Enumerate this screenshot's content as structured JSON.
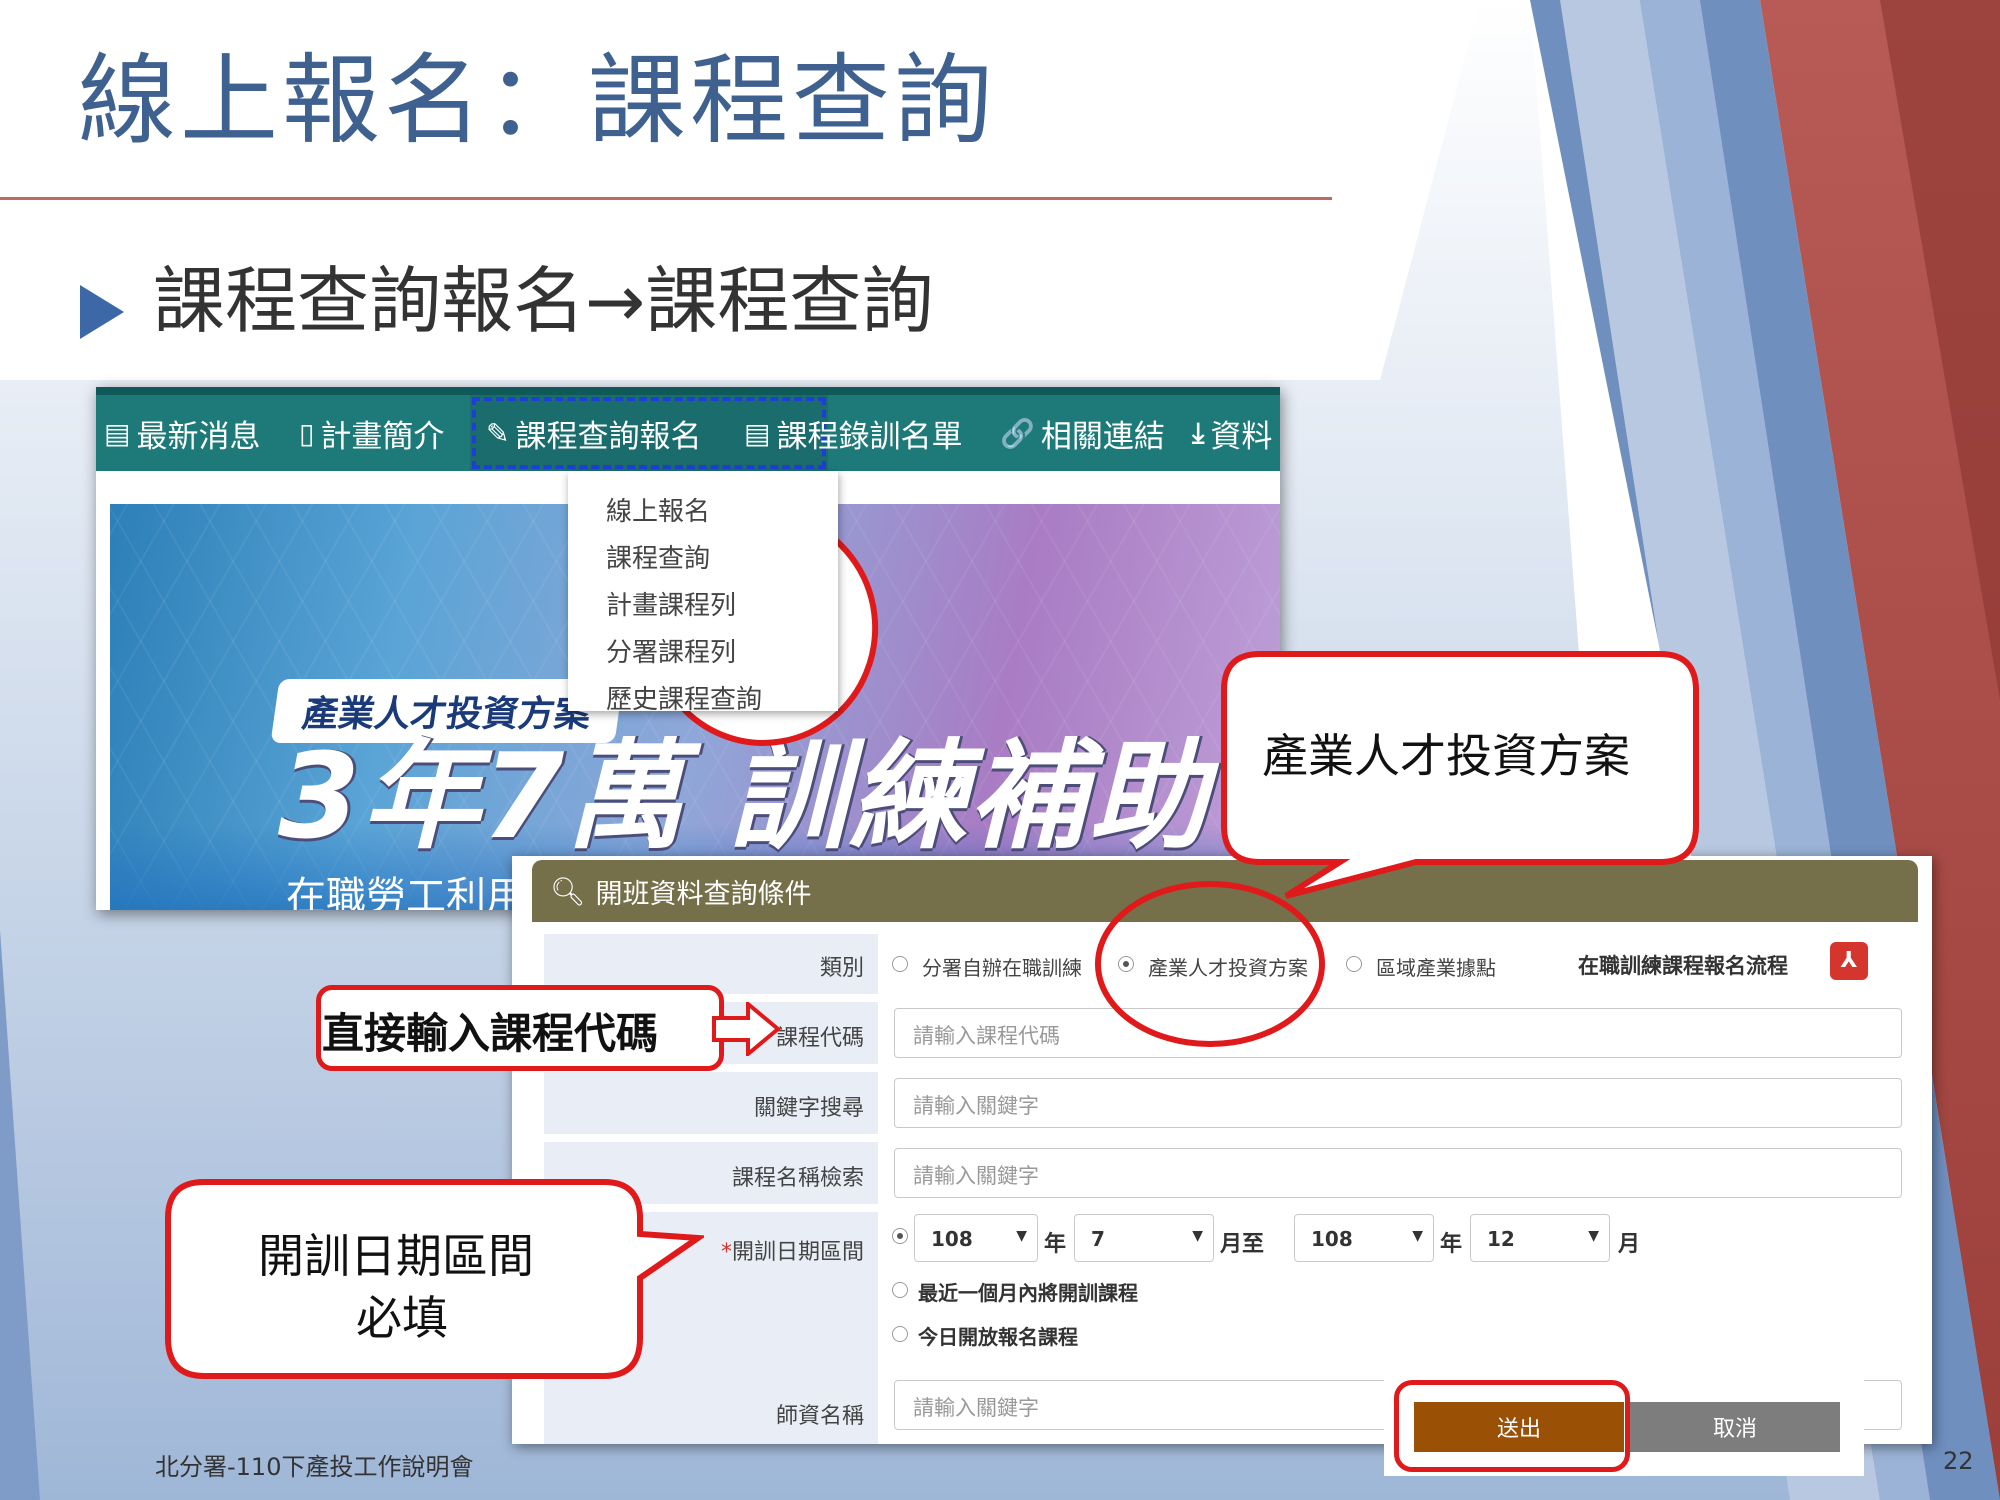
{
  "slide": {
    "title": "線上報名：課程查詢",
    "bullet": "課程查詢報名→課程查詢",
    "footer": "北分署-110下產投工作說明會",
    "page_number": "22"
  },
  "website": {
    "nav_items": [
      {
        "icon": "newspaper-icon",
        "label": "最新消息"
      },
      {
        "icon": "clipboard-icon",
        "label": "計畫簡介"
      },
      {
        "icon": "pencil-icon",
        "label": "課程查詢報名"
      },
      {
        "icon": "list-icon",
        "label": "課程錄訓名單"
      },
      {
        "icon": "link-icon",
        "label": "相關連結"
      },
      {
        "icon": "download-icon",
        "label": "資料"
      }
    ],
    "dropdown_items": [
      "線上報名",
      "課程查詢",
      "計畫課程列",
      "分署課程列",
      "歷史課程查詢"
    ],
    "banner": {
      "tag": "產業人才投資方案",
      "headline": "3年7萬 訓練補助",
      "subline": "在職勞工利用政府資源 提升技能以因應產業快速變動"
    }
  },
  "callouts": {
    "course_query": "課程\n查詢",
    "program": "產業人才投資方案",
    "enter_code": "直接輸入課程代碼",
    "date_range_line1": "開訓日期區間",
    "date_range_line2": "必填"
  },
  "form": {
    "header": "開班資料查詢條件",
    "category": {
      "label": "類別",
      "options": [
        {
          "text": "分署自辦在職訓練",
          "selected": false
        },
        {
          "text": "產業人才投資方案",
          "selected": true
        },
        {
          "text": "區域產業據點",
          "selected": false
        }
      ],
      "process_link": "在職訓練課程報名流程"
    },
    "course_code": {
      "label": "課程代碼",
      "placeholder": "請輸入課程代碼"
    },
    "keyword": {
      "label": "關鍵字搜尋",
      "placeholder": "請輸入關鍵字"
    },
    "course_name": {
      "label": "課程名稱檢索",
      "placeholder": "請輸入關鍵字"
    },
    "date_range": {
      "required_mark": "*",
      "label": "開訓日期區間",
      "from_year": "108",
      "year_unit": "年",
      "from_month": "7",
      "month_to": "月至",
      "to_year": "108",
      "to_month": "12",
      "month_unit": "月",
      "option_next_month": "最近一個月內將開訓課程",
      "option_today": "今日開放報名課程"
    },
    "teacher": {
      "label": "師資名稱",
      "placeholder": "請輸入關鍵字"
    },
    "submit_label": "送出",
    "cancel_label": "取消"
  },
  "colors": {
    "title_blue": "#3f6190",
    "nav_teal": "#1e7a79",
    "panel_olive": "#75704a",
    "submit_brown": "#9a5106",
    "cancel_gray": "#7d7d7d",
    "callout_red": "#e0191b",
    "slide_deco_red": "#a8403c",
    "slide_deco_blue": "#8aa6cc"
  }
}
